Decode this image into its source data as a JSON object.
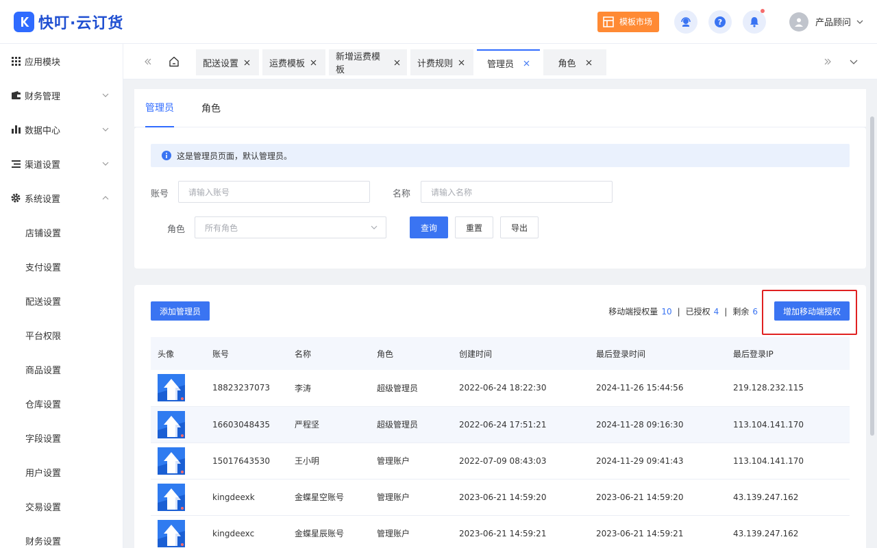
{
  "header": {
    "logo_text": "快叮·云订货",
    "template_market": "模板市场",
    "user_name": "产品顾问"
  },
  "sidebar": {
    "items": [
      {
        "label": "应用模块"
      },
      {
        "label": "财务管理"
      },
      {
        "label": "数据中心"
      },
      {
        "label": "渠道设置"
      },
      {
        "label": "系统设置"
      }
    ],
    "sub_items": [
      "店铺设置",
      "支付设置",
      "配送设置",
      "平台权限",
      "商品设置",
      "仓库设置",
      "字段设置",
      "用户设置",
      "交易设置",
      "财务设置"
    ]
  },
  "tabs": [
    {
      "label": "配送设置"
    },
    {
      "label": "运费模板"
    },
    {
      "label": "新增运费模板"
    },
    {
      "label": "计费规则"
    },
    {
      "label": "管理员"
    },
    {
      "label": "角色"
    }
  ],
  "subtabs": [
    "管理员",
    "角色"
  ],
  "filter": {
    "alert": "这是管理员页面，默认管理员。",
    "account_label": "账号",
    "account_placeholder": "请输入账号",
    "name_label": "名称",
    "name_placeholder": "请输入名称",
    "role_label": "角色",
    "role_value": "所有角色",
    "query": "查询",
    "reset": "重置",
    "export": "导出"
  },
  "list": {
    "add_button": "添加管理员",
    "mobile_quota_label": "移动端授权量",
    "mobile_quota": "10",
    "authorized_label": "已授权",
    "authorized": "4",
    "remaining_label": "剩余",
    "remaining": "6",
    "sep": "|",
    "add_mobile_auth": "增加移动端授权",
    "columns": [
      "头像",
      "账号",
      "名称",
      "角色",
      "创建时间",
      "最后登录时间",
      "最后登录IP"
    ],
    "rows": [
      {
        "account": "18823237073",
        "name": "李涛",
        "role": "超级管理员",
        "created": "2022-06-24 18:22:30",
        "last_login": "2024-11-26 15:44:56",
        "ip": "219.128.232.115"
      },
      {
        "account": "16603048435",
        "name": "严程坚",
        "role": "超级管理员",
        "created": "2022-06-24 17:51:21",
        "last_login": "2024-11-28 09:16:30",
        "ip": "113.104.141.170"
      },
      {
        "account": "15017643530",
        "name": "王小明",
        "role": "管理账户",
        "created": "2022-07-09 08:43:03",
        "last_login": "2024-11-29 09:41:43",
        "ip": "113.104.141.170"
      },
      {
        "account": "kingdeexk",
        "name": "金蝶星空账号",
        "role": "管理账户",
        "created": "2023-06-21 14:59:20",
        "last_login": "2023-06-21 14:59:20",
        "ip": "43.139.247.162"
      },
      {
        "account": "kingdeexc",
        "name": "金蝶星辰账号",
        "role": "管理账户",
        "created": "2023-06-21 14:59:21",
        "last_login": "2023-06-21 14:59:21",
        "ip": "43.139.247.162"
      }
    ]
  },
  "colors": {
    "primary": "#3a74f2",
    "orange": "#ff8a34",
    "highlight": "#e02020"
  }
}
